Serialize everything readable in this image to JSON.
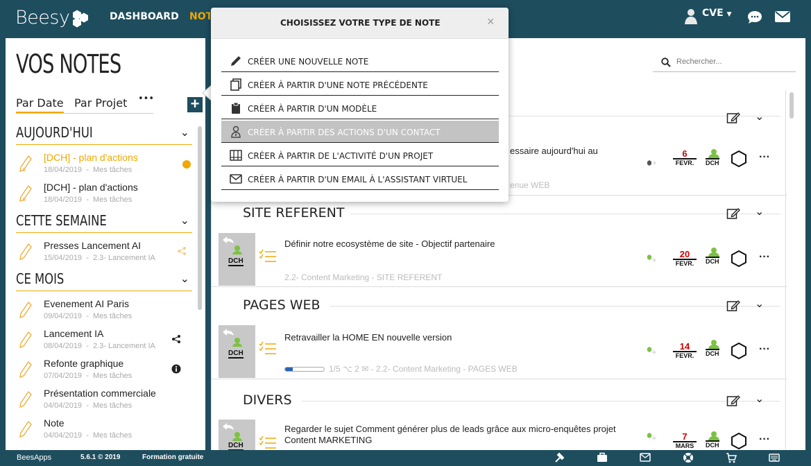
{
  "app": {
    "logo_text": "Beesy",
    "accent": "#f0a800",
    "brand": "#1e4d5e"
  },
  "nav": {
    "dashboard": "DASHBOARD",
    "notes": "NOTES",
    "user": "CVE"
  },
  "left": {
    "title": "VOS NOTES",
    "tabs": [
      "Par Date",
      "Par Projet",
      "•••"
    ],
    "sections": [
      {
        "title": "AUJOURD'HUI",
        "items": [
          {
            "title": "[DCH] - plan d'actions",
            "date": "18/04/2019",
            "project": "Mes tâches"
          },
          {
            "title": "[DCH] - plan d'actions",
            "date": "18/04/2019",
            "project": "Mes tâches"
          }
        ]
      },
      {
        "title": "CETTE SEMAINE",
        "items": [
          {
            "title": "Presses Lancement AI",
            "date": "15/04/2019",
            "project": "2.3- Lancement IA"
          }
        ]
      },
      {
        "title": "CE MOIS",
        "items": [
          {
            "title": "Evenement AI Paris",
            "date": "09/04/2019",
            "project": "Mes tâches"
          },
          {
            "title": "Lancement IA",
            "date": "08/04/2019",
            "project": "2.3- Lancement IA"
          },
          {
            "title": "Refonte graphique",
            "date": "07/04/2019",
            "project": "Mes tâches"
          },
          {
            "title": "Présentation commerciale",
            "date": "04/04/2019",
            "project": "Mes tâches"
          },
          {
            "title": "Note",
            "date": "04/04/2019",
            "project": "Mes tâches"
          }
        ]
      }
    ],
    "separator": "-"
  },
  "main": {
    "search_placeholder": "Rechercher...",
    "top_task": {
      "title_partial": "essaire aujourd'hui au",
      "meta_partial": "enue WEB",
      "day": "6",
      "month": "FEVR.",
      "user": "DCH"
    },
    "groups": [
      {
        "title": "SITE REFERENT",
        "task": {
          "thumb_user": "DCH",
          "title": "Définir notre ecosystème de site - Objectif partenaire",
          "meta": "2.2- Content Marketing - SITE REFERENT",
          "day": "20",
          "month": "FEVR.",
          "user": "DCH"
        }
      },
      {
        "title": "PAGES WEB",
        "task": {
          "thumb_user": "DCH",
          "title": "Retravailler la HOME EN nouvelle version",
          "meta": "1/5 ⌥ 2 ✉ - 2.2- Content Marketing - PAGES WEB",
          "progress": 0.2,
          "day": "14",
          "month": "FEVR.",
          "user": "DCH"
        }
      },
      {
        "title": "DIVERS",
        "task": {
          "thumb_user": "DCH",
          "title": "Regarder le sujet Comment générer plus de leads grâce aux micro-enquêtes projet Content MARKETING",
          "meta": "",
          "day": "7",
          "month": "MARS",
          "user": "DCH"
        }
      }
    ]
  },
  "popup": {
    "title": "CHOISISSEZ VOTRE TYPE DE NOTE",
    "close": "×",
    "items": [
      {
        "label": "CRÉER UNE NOUVELLE NOTE",
        "icon": "pencil-icon"
      },
      {
        "label": "CRÉER À PARTIR D'UNE NOTE PRÉCÉDENTE",
        "icon": "copy-icon"
      },
      {
        "label": "CRÉER À PARTIR D'UN MODÈLE",
        "icon": "clipboard-icon"
      },
      {
        "label": "CRÉER À PARTIR DES ACTIONS D'UN CONTACT",
        "icon": "contact-icon",
        "highlighted": true
      },
      {
        "label": "CRÉER À PARTIR DE L'ACTIVITÉ D'UN PROJET",
        "icon": "project-icon"
      },
      {
        "label": "CRÉER À PARTIR D'UN EMAIL À L'ASSISTANT VIRTUEL",
        "icon": "mail-icon"
      }
    ]
  },
  "footer": {
    "brand": "BeesApps",
    "version": "5.6.1 © 2019",
    "training": "Formation gratuite"
  }
}
